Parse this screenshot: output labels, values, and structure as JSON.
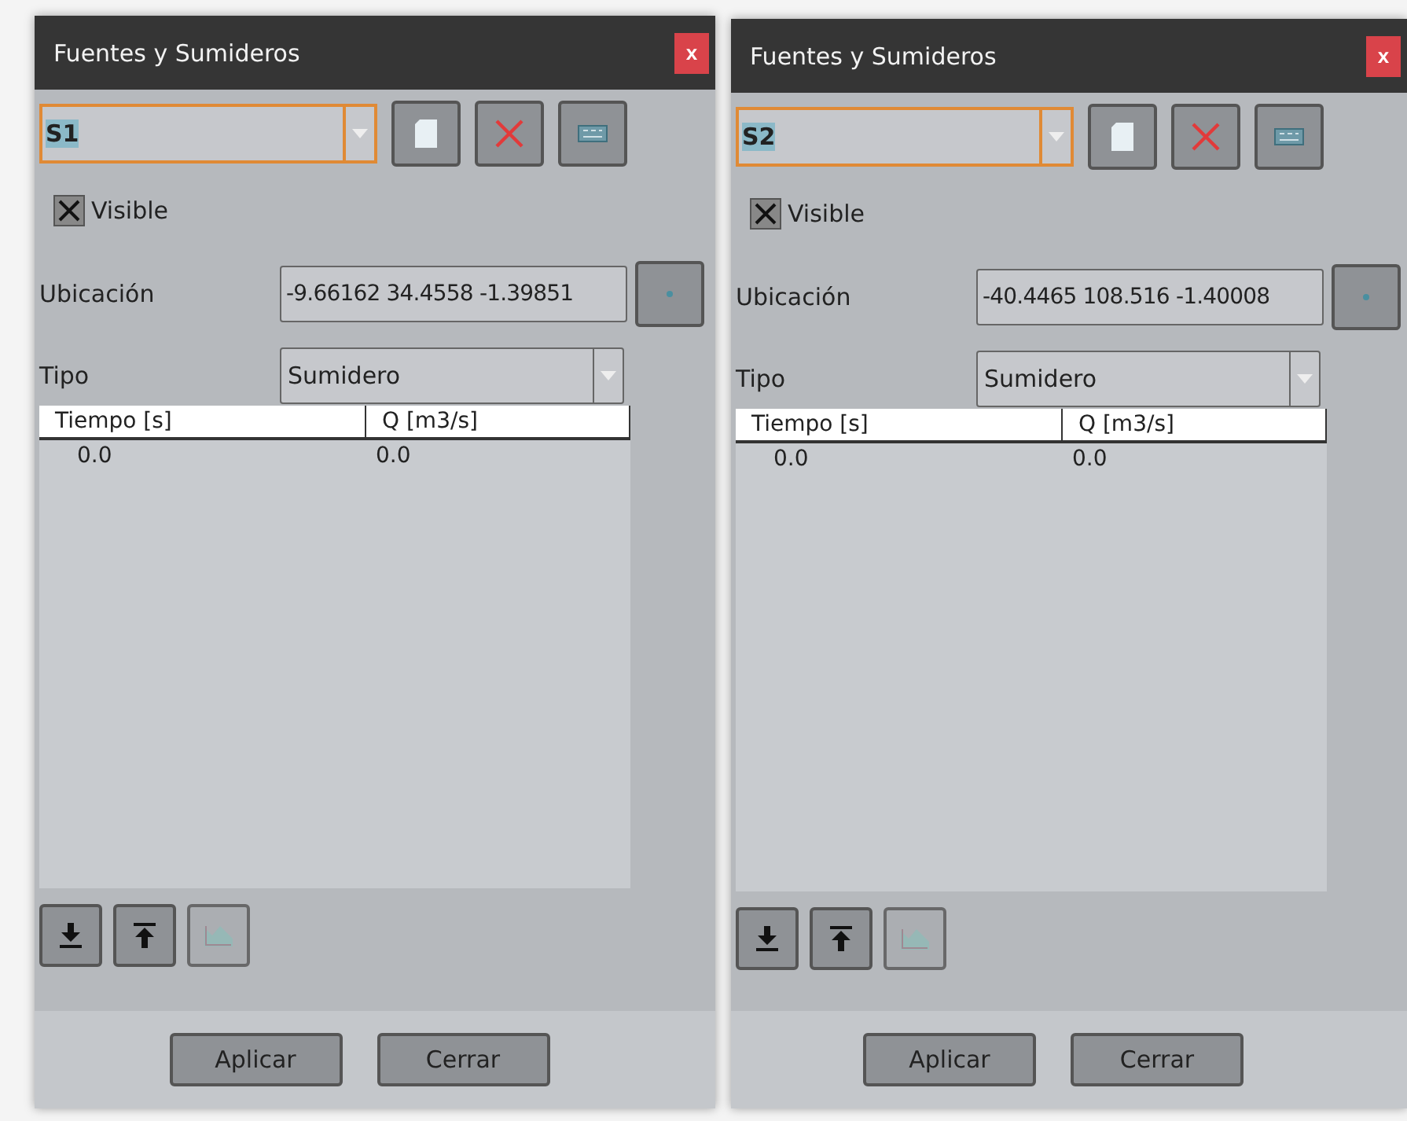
{
  "dialogs": [
    {
      "title": "Fuentes y Sumideros",
      "close": "x",
      "selector": {
        "value": "S1",
        "focused": true
      },
      "visible": {
        "label": "Visible",
        "checked": true
      },
      "location": {
        "label": "Ubicación",
        "value": "-9.66162 34.4558 -1.39851"
      },
      "type": {
        "label": "Tipo",
        "value": "Sumidero"
      },
      "table": {
        "columns": [
          "Tiempo [s]",
          "Q [m3/s]"
        ],
        "rows": [
          [
            "0.0",
            "0.0"
          ]
        ]
      },
      "tools": [
        {
          "kind": "download",
          "disabled": false
        },
        {
          "kind": "upload",
          "disabled": false
        },
        {
          "kind": "chart",
          "disabled": true
        }
      ],
      "buttons": [
        "Aplicar",
        "Cerrar"
      ]
    },
    {
      "title": "Fuentes y Sumideros",
      "close": "x",
      "selector": {
        "value": "S2",
        "focused": true
      },
      "visible": {
        "label": "Visible",
        "checked": true
      },
      "location": {
        "label": "Ubicación",
        "value": "-40.4465 108.516 -1.40008"
      },
      "type": {
        "label": "Tipo",
        "value": "Sumidero"
      },
      "table": {
        "columns": [
          "Tiempo [s]",
          "Q [m3/s]"
        ],
        "rows": [
          [
            "0.0",
            "0.0"
          ]
        ]
      },
      "tools": [
        {
          "kind": "download",
          "disabled": false
        },
        {
          "kind": "upload",
          "disabled": false
        },
        {
          "kind": "chart",
          "disabled": true
        }
      ],
      "buttons": [
        "Aplicar",
        "Cerrar"
      ]
    }
  ]
}
